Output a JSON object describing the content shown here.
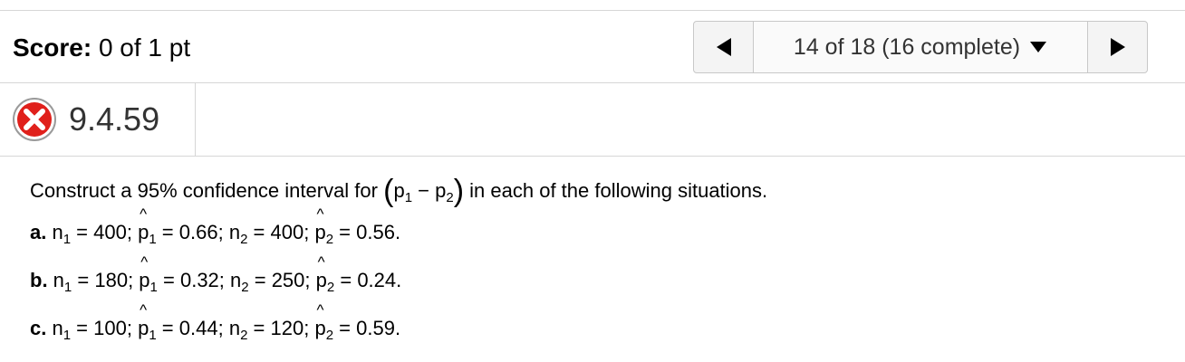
{
  "score": {
    "label": "Score:",
    "value": "0 of 1 pt"
  },
  "nav": {
    "progress": "14 of 18 (16 complete)"
  },
  "question": {
    "id": "9.4.59",
    "status": "incorrect"
  },
  "prompt": {
    "before": "Construct a 95% confidence interval for",
    "open_paren": "(",
    "p1": "p",
    "sub1": "1",
    "minus": " − ",
    "p2": "p",
    "sub2": "2",
    "close_paren": ")",
    "after": "in each of the following situations."
  },
  "items": [
    {
      "letter": "a.",
      "n1": "400",
      "p1": "0.66",
      "n2": "400",
      "p2": "0.56"
    },
    {
      "letter": "b.",
      "n1": "180",
      "p1": "0.32",
      "n2": "250",
      "p2": "0.24"
    },
    {
      "letter": "c.",
      "n1": "100",
      "p1": "0.44",
      "n2": "120",
      "p2": "0.59"
    }
  ],
  "colors": {
    "incorrect": "#e0201b",
    "border": "#d6d6d6"
  },
  "icons": {
    "status": "x-circle-icon",
    "prev": "triangle-left-icon",
    "next": "triangle-right-icon",
    "dropdown": "caret-down-icon"
  }
}
